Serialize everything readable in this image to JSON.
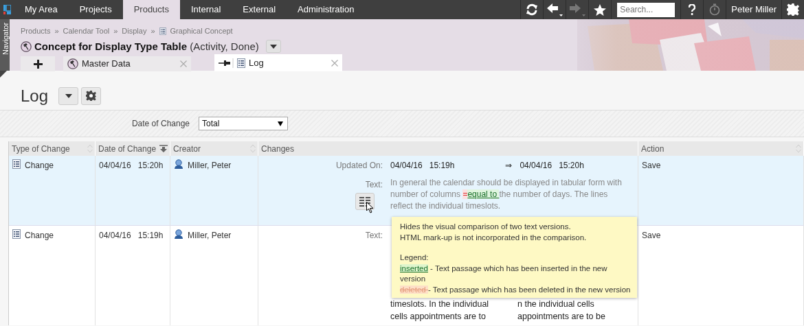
{
  "top_nav": {
    "tabs": [
      {
        "label": "My Area",
        "selected": false
      },
      {
        "label": "Projects",
        "selected": false
      },
      {
        "label": "Products",
        "selected": true
      },
      {
        "label": "Internal",
        "selected": false
      },
      {
        "label": "External",
        "selected": false
      },
      {
        "label": "Administration",
        "selected": false
      }
    ],
    "search": {
      "placeholder": "Search..."
    },
    "user": "Peter Miller"
  },
  "navigator": {
    "label": "Navigator"
  },
  "breadcrumb": {
    "separator": "»",
    "items": [
      "Products",
      "Calendar Tool",
      "Display",
      "Graphical Concept"
    ]
  },
  "title": {
    "name": "Concept for Display Type Table",
    "status": "(Activity, Done)"
  },
  "object_tabs": [
    {
      "kind": "add"
    },
    {
      "kind": "tab",
      "label": "Master Data",
      "selected": false
    },
    {
      "kind": "tab",
      "label": "Log",
      "selected": true
    }
  ],
  "page": {
    "title": "Log"
  },
  "filter": {
    "label": "Date of Change",
    "value": "Total"
  },
  "table": {
    "columns": [
      {
        "label": "Type of Change",
        "sortable": true,
        "sorted": false
      },
      {
        "label": "Date of Change",
        "sortable": true,
        "sorted": true
      },
      {
        "label": "Creator",
        "sortable": true,
        "sorted": false
      },
      {
        "label": "Changes",
        "sortable": false,
        "sorted": false
      },
      {
        "label": "Action",
        "sortable": true,
        "sorted": false
      }
    ],
    "rows": [
      {
        "selected": true,
        "type": "Change",
        "date": "04/04/16   15:20h",
        "creator": "Miller, Peter",
        "action": "Save",
        "changes": [
          {
            "kind": "value",
            "label": "Updated On:",
            "old": "04/04/16   15:19h",
            "arrow": "⇒",
            "new": "04/04/16   15:20h"
          },
          {
            "kind": "diff",
            "label": "Text:",
            "segments": [
              {
                "kind": "plain",
                "text": "In general the calendar should be displayed in tabular form with number of columns "
              },
              {
                "kind": "deleted",
                "text": "="
              },
              {
                "kind": "inserted",
                "text": "equal "
              },
              {
                "kind": "inserted",
                "text": "to "
              },
              {
                "kind": "plain",
                "text": "the number of days. The lines reflect the individual timeslots."
              }
            ]
          }
        ]
      },
      {
        "selected": false,
        "type": "Change",
        "date": "04/04/16   15:19h",
        "creator": "Miller, Peter",
        "action": "Save",
        "changes": [
          {
            "kind": "columns",
            "label": "Text:",
            "old": "timeslots. In the individual cells appointments are to",
            "new": "n the individual cells appointments are to be"
          }
        ]
      }
    ]
  },
  "tooltip": {
    "lines": [
      "Hides the visual comparison of two text versions.",
      "HTML mark-up is not incorporated in the comparison."
    ],
    "legend_title": "Legend:",
    "legend": [
      {
        "kind": "inserted",
        "sample": "inserted",
        "text": " - Text passage which has been inserted in the new version"
      },
      {
        "kind": "deleted",
        "sample": "deleted ",
        "text": "- Text passage which has been deleted in the new version"
      }
    ]
  }
}
